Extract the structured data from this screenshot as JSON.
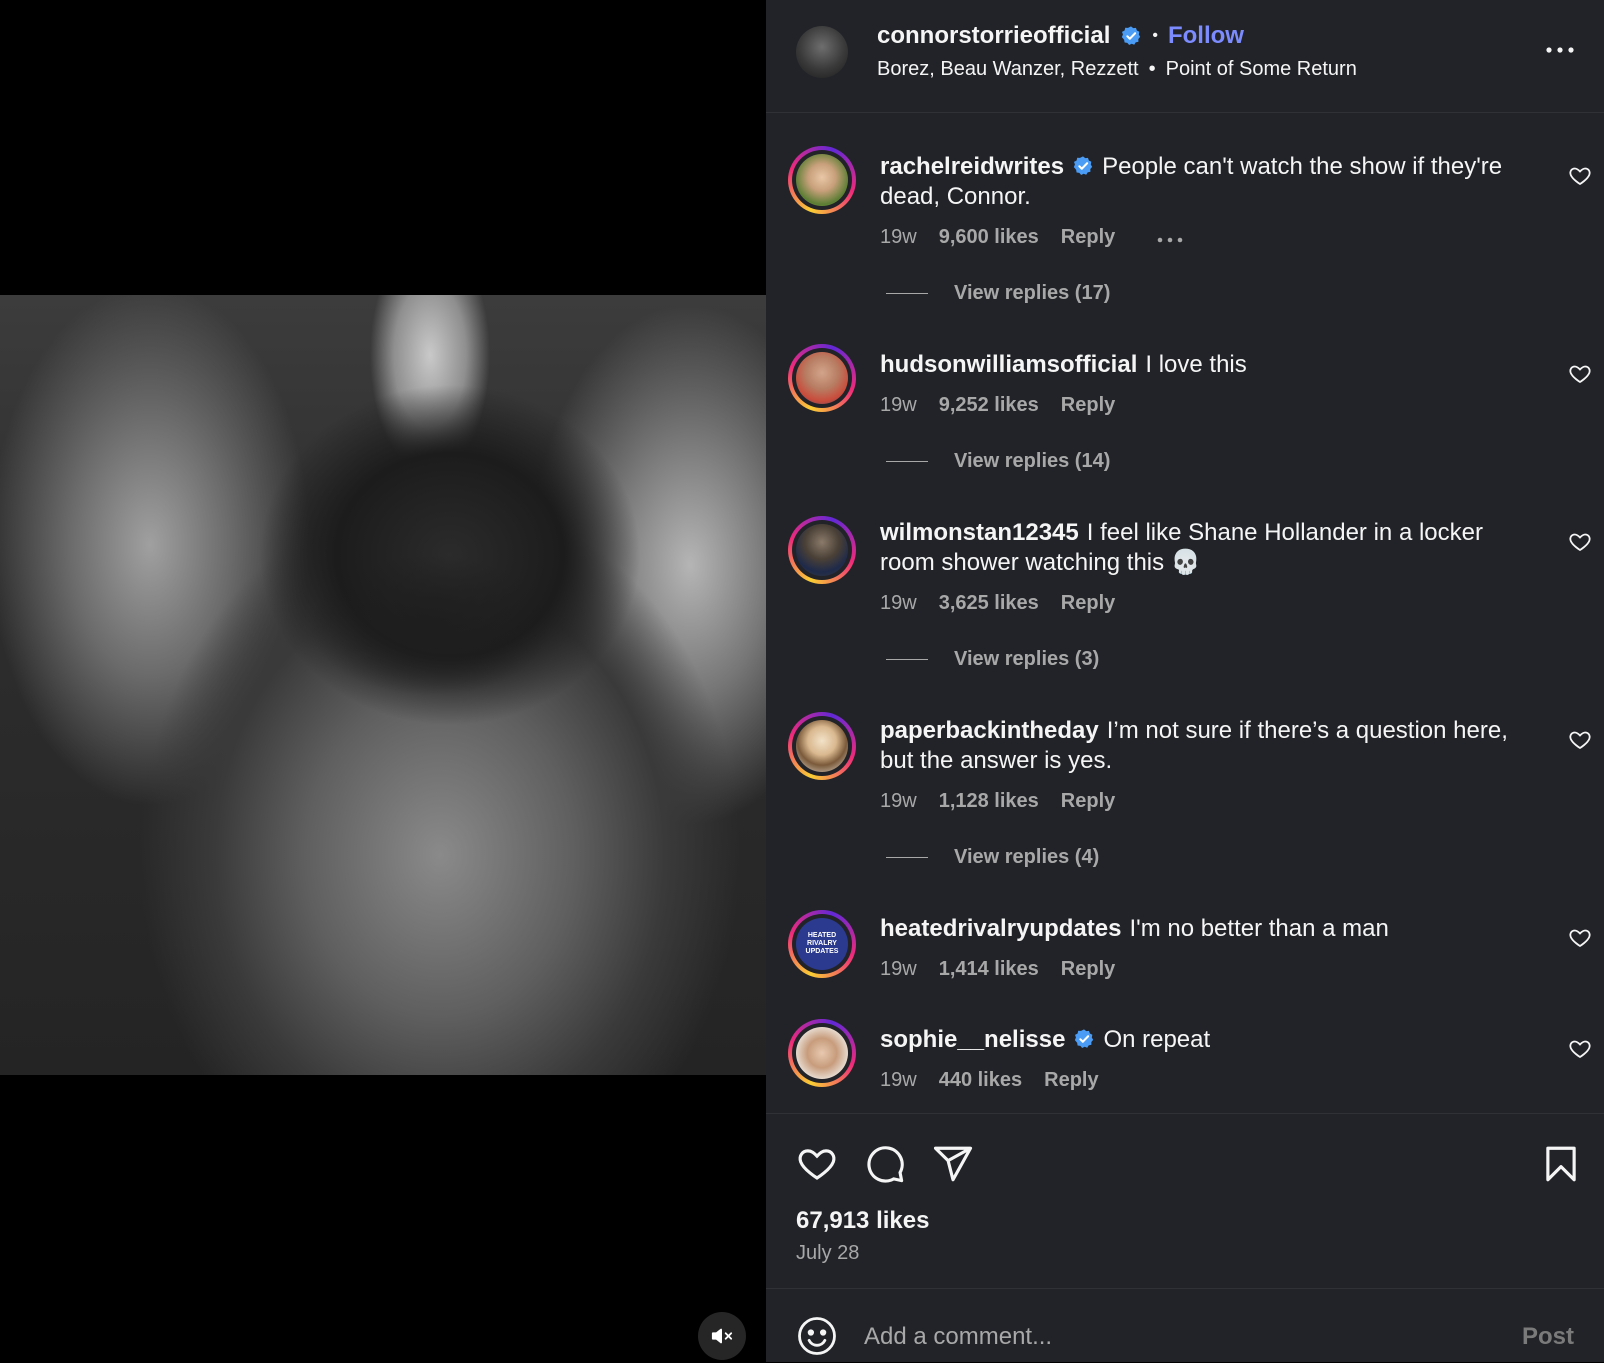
{
  "post": {
    "username": "connorstorrieofficial",
    "follow_label": "Follow",
    "separator": "•",
    "audio_artists": "Borez, Beau Wanzer, Rezzett",
    "audio_title": "Point of Some Return",
    "likes": "67,913 likes",
    "date": "July 28"
  },
  "comments": [
    {
      "username": "rachelreidwrites",
      "verified": true,
      "text": "People can't watch the show if they're dead, Connor.",
      "time": "19w",
      "likes": "9,600 likes",
      "reply_label": "Reply",
      "view_replies": "View replies (17)"
    },
    {
      "username": "hudsonwilliamsofficial",
      "verified": false,
      "text": "I love this",
      "time": "19w",
      "likes": "9,252 likes",
      "reply_label": "Reply",
      "view_replies": "View replies (14)"
    },
    {
      "username": "wilmonstan12345",
      "verified": false,
      "text": "I feel like Shane Hollander in a locker room shower watching this 💀",
      "time": "19w",
      "likes": "3,625 likes",
      "reply_label": "Reply",
      "view_replies": "View replies (3)"
    },
    {
      "username": "paperbackintheday",
      "verified": false,
      "text": "I’m not sure if there’s a question here, but the answer is yes.",
      "time": "19w",
      "likes": "1,128 likes",
      "reply_label": "Reply",
      "view_replies": "View replies (4)"
    },
    {
      "username": "heatedrivalryupdates",
      "verified": false,
      "text": "I'm no better than a man",
      "time": "19w",
      "likes": "1,414 likes",
      "reply_label": "Reply",
      "view_replies": ""
    },
    {
      "username": "sophie__nelisse",
      "verified": true,
      "text": "On repeat",
      "time": "19w",
      "likes": "440 likes",
      "reply_label": "Reply",
      "view_replies": ""
    }
  ],
  "comment_box": {
    "placeholder": "Add a comment...",
    "post_label": "Post"
  },
  "avatar_text": {
    "heatedrivalryupdates": "HEATED RIVALRY UPDATES"
  },
  "colors": {
    "panel_bg": "#212328",
    "accent": "#7c8cff",
    "verified": "#4a9cf5",
    "muted": "#a8a8a8"
  },
  "icons": {
    "verified": "verified-badge-icon",
    "heart": "heart-icon",
    "comment": "comment-icon",
    "share": "send-icon",
    "save": "bookmark-icon",
    "emoji": "emoji-icon",
    "more": "more-horizontal-icon",
    "mute": "muted-speaker-icon"
  }
}
